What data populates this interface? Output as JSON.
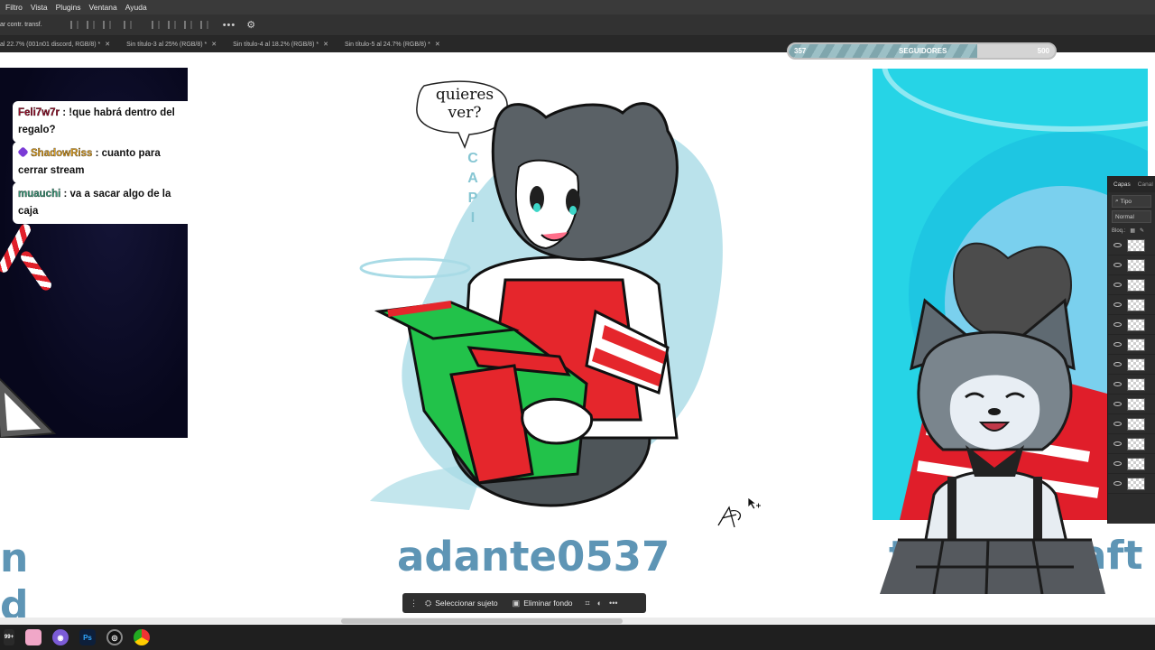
{
  "menu": [
    "Filtro",
    "Vista",
    "Plugins",
    "Ventana",
    "Ayuda"
  ],
  "options_bar": {
    "label": "ar contr. transf."
  },
  "tabs": [
    "al 22.7% (001n01 discord, RGB/8) *",
    "Sin título-3 al 25% (RGB/8) *",
    "Sin título-4 al 18.2% (RGB/8) *",
    "Sin título-5 al 24.7% (RGB/8) *"
  ],
  "followers": {
    "current": "357",
    "label": "SEGUIDORES",
    "goal": "500",
    "progress": 0.71
  },
  "chat": [
    {
      "user": "Feli7w7r",
      "user_color": "#9b0f2a",
      "text": " : !que habrá dentro del regalo?"
    },
    {
      "user": "ShadowRiss",
      "user_color": "#e0a020",
      "badge": "purple-gem-icon",
      "text": " : cuanto para cerrar stream"
    },
    {
      "user": "muauchi",
      "user_color": "#3a9a7a",
      "text": " : va a sacar algo de la caja"
    }
  ],
  "artwork": {
    "speech_bubble": "quieres ver?",
    "side_text": "CAPI",
    "credit_center": "adante0537",
    "credit_right_partial": "t",
    "credit_right_partial2": "raft",
    "credit_left_partial": "n",
    "credit_left_partial2": "d"
  },
  "layers_panel": {
    "tab1": "Capas",
    "tab2": "Canal",
    "filter": "Tipo",
    "blend": "Normal",
    "lock": "Bloq.:",
    "rows": 13
  },
  "task_bar": {
    "select_subject": "Seleccionar sujeto",
    "remove_bg": "Eliminar fondo"
  },
  "windows_taskbar": {
    "badge": "99+"
  }
}
